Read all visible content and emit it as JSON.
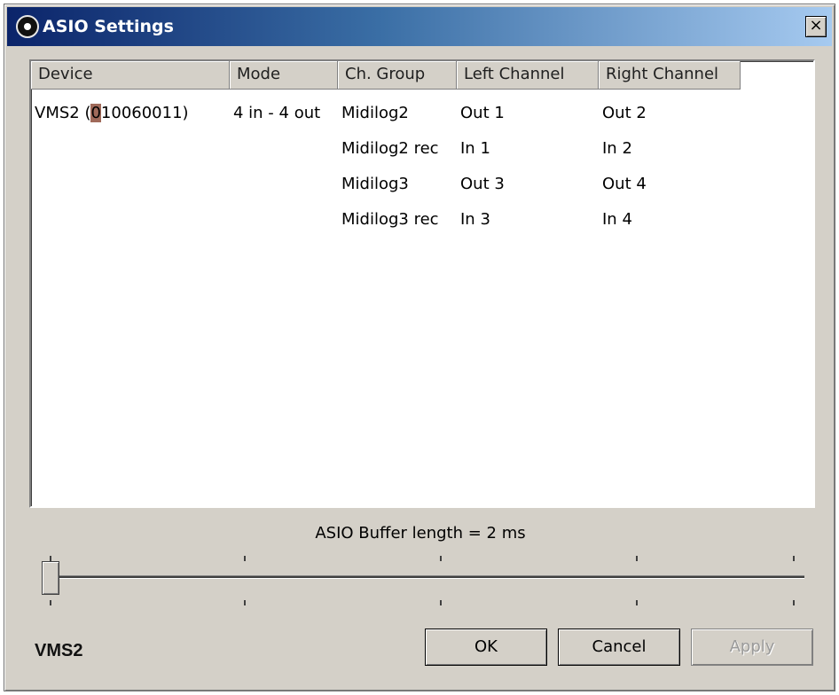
{
  "window": {
    "title": "ASIO Settings",
    "close_label": "×"
  },
  "table": {
    "columns": [
      "Device",
      "Mode",
      "Ch. Group",
      "Left Channel",
      "Right Channel"
    ],
    "rows": [
      {
        "device_prefix": "VMS2 (",
        "device_highlight": "0",
        "device_suffix": "10060011)",
        "mode": "4 in - 4 out",
        "group": "Midilog2",
        "left": "Out 1",
        "right": "Out 2"
      },
      {
        "device_prefix": "",
        "device_highlight": "",
        "device_suffix": "",
        "mode": "",
        "group": "Midilog2 rec",
        "left": "In 1",
        "right": "In 2"
      },
      {
        "device_prefix": "",
        "device_highlight": "",
        "device_suffix": "",
        "mode": "",
        "group": "Midilog3",
        "left": "Out 3",
        "right": "Out 4"
      },
      {
        "device_prefix": "",
        "device_highlight": "",
        "device_suffix": "",
        "mode": "",
        "group": "Midilog3 rec",
        "left": "In 3",
        "right": "In 4"
      }
    ]
  },
  "buffer": {
    "label": "ASIO Buffer length = 2 ms",
    "slider_value": 0,
    "slider_steps": 4
  },
  "footer": {
    "brand": "VMS2",
    "ok_label": "OK",
    "cancel_label": "Cancel",
    "apply_label": "Apply"
  },
  "colors": {
    "titlebar_start": "#0b246a",
    "titlebar_end": "#a6caf0",
    "dialog_bg": "#d4d0c8",
    "caret_highlight": "#a06a5a"
  }
}
